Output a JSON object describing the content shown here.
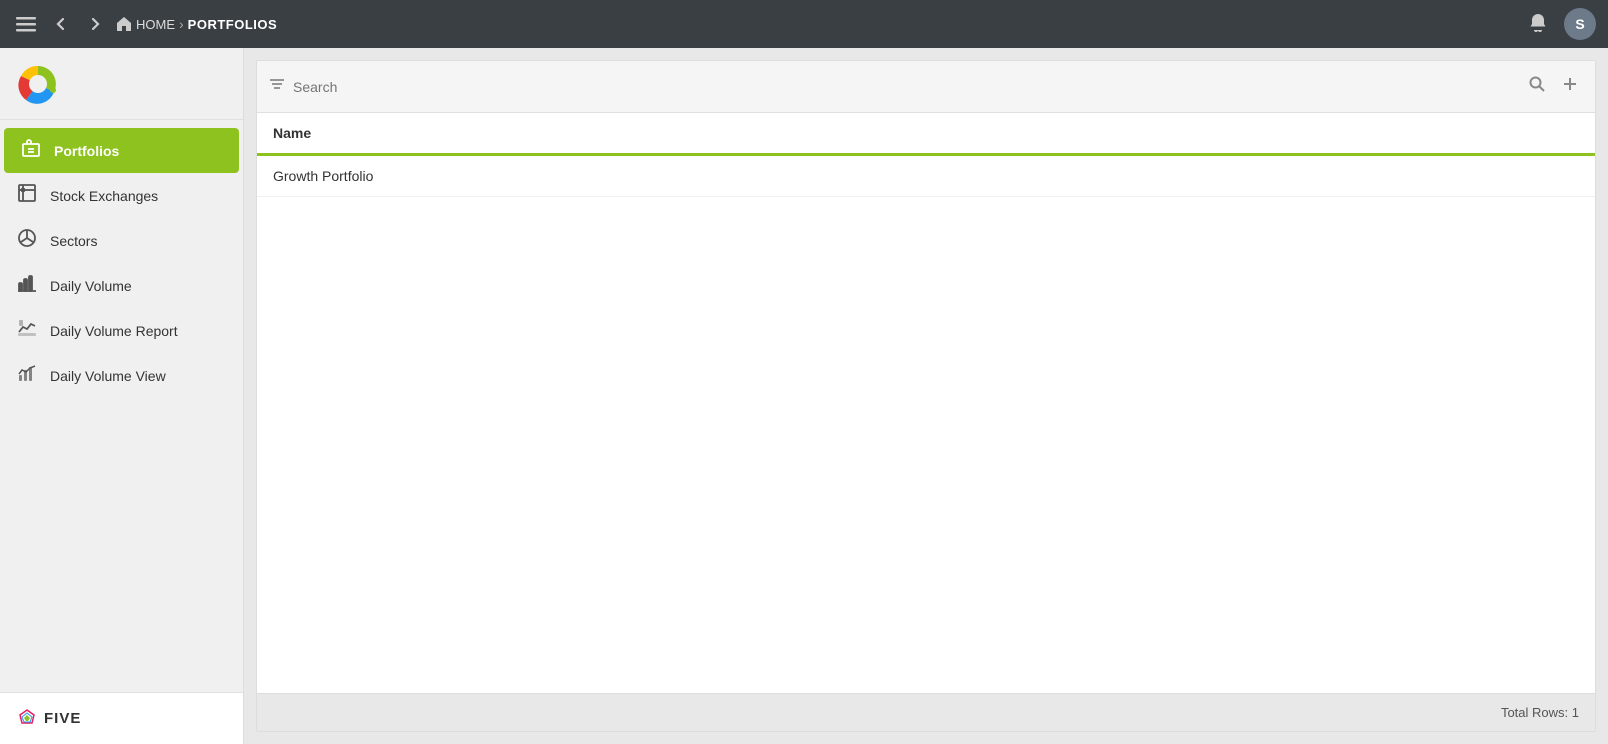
{
  "topbar": {
    "home_label": "HOME",
    "separator": "›",
    "current_page": "PORTFOLIOS",
    "avatar_initials": "S"
  },
  "sidebar": {
    "items": [
      {
        "id": "portfolios",
        "label": "Portfolios",
        "active": true
      },
      {
        "id": "stock-exchanges",
        "label": "Stock Exchanges",
        "active": false
      },
      {
        "id": "sectors",
        "label": "Sectors",
        "active": false
      },
      {
        "id": "daily-volume",
        "label": "Daily Volume",
        "active": false
      },
      {
        "id": "daily-volume-report",
        "label": "Daily Volume Report",
        "active": false
      },
      {
        "id": "daily-volume-view",
        "label": "Daily Volume View",
        "active": false
      }
    ],
    "footer_brand": "FIVE"
  },
  "toolbar": {
    "search_placeholder": "Search"
  },
  "table": {
    "column_name": "Name",
    "rows": [
      {
        "name": "Growth Portfolio"
      }
    ],
    "footer_text": "Total Rows: 1"
  }
}
